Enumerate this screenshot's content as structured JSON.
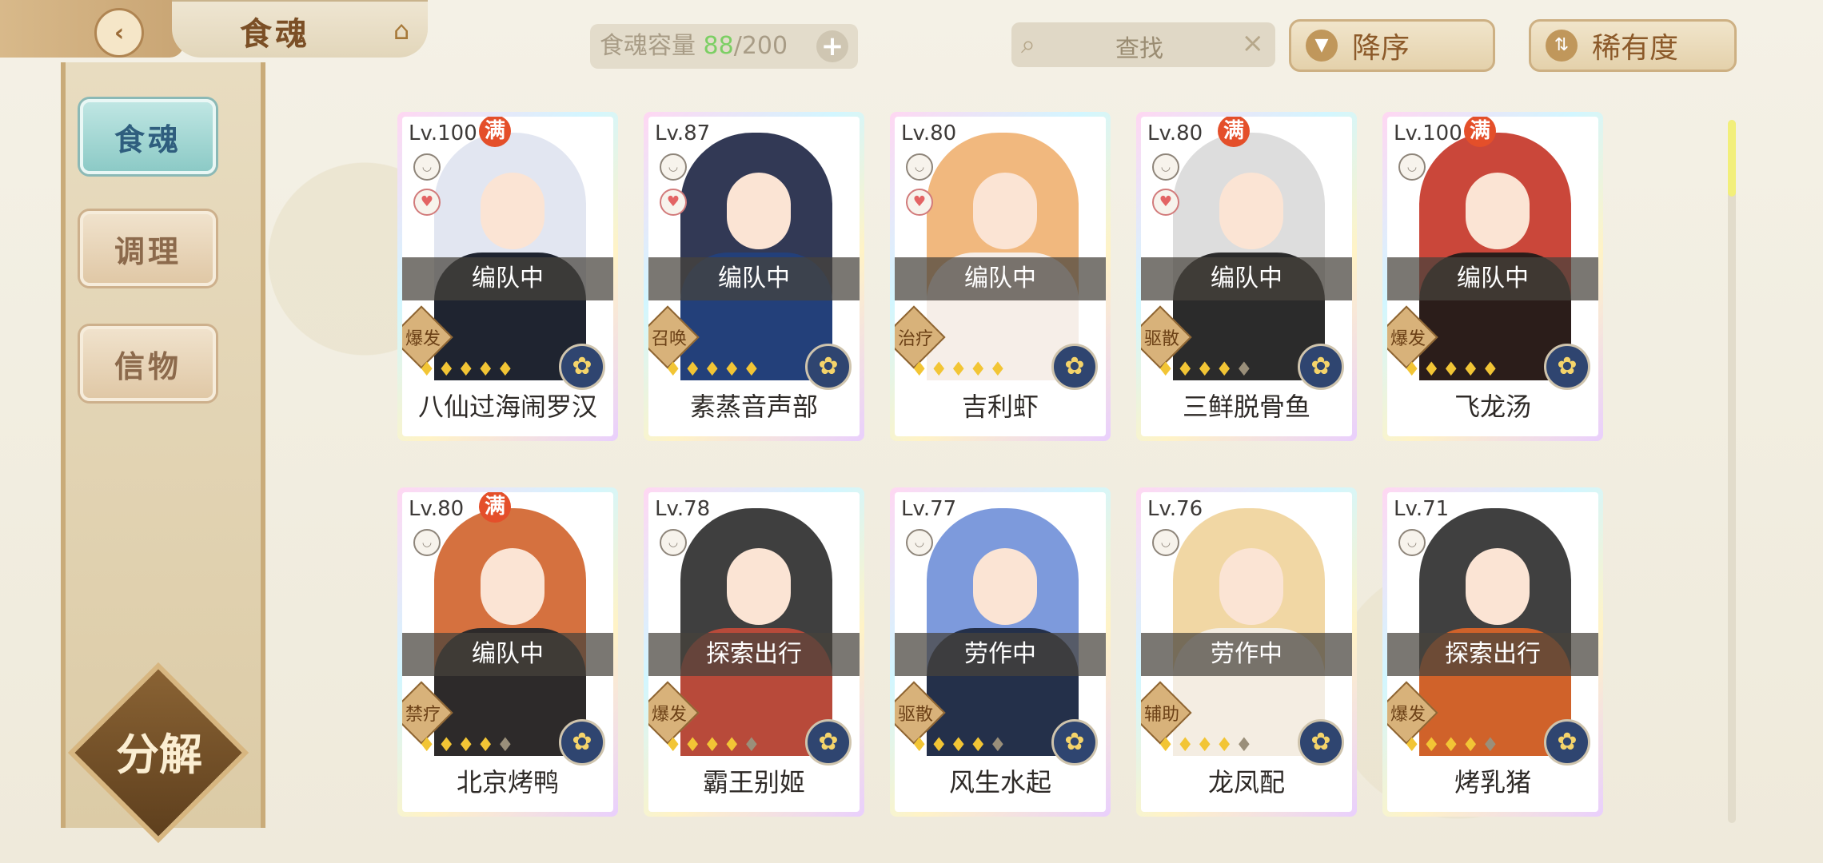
{
  "header": {
    "back_icon": "back-arrow-icon",
    "title": "食魂",
    "crown_icon": "pavilion-icon",
    "capacity_label": "食魂容量",
    "capacity_current": "88",
    "capacity_total": "/200",
    "capacity_add": "+",
    "search_placeholder": "查找",
    "search_clear": "×",
    "sort_order_label": "降序",
    "sort_key_label": "稀有度"
  },
  "sidebar": {
    "tabs": [
      {
        "label": "食魂",
        "active": true
      },
      {
        "label": "调理",
        "active": false
      },
      {
        "label": "信物",
        "active": false
      }
    ],
    "decompose_label": "分解"
  },
  "colors": {
    "accent": "#c9a574",
    "active_tab": "#8ccac6",
    "capacity_current": "#7ccf64",
    "full_badge": "#e44f2a"
  },
  "cards": [
    {
      "level": "Lv.100",
      "full": "满",
      "status": "编队中",
      "role": "爆发",
      "stars": 5,
      "name": "八仙过海闹罗汉",
      "heart": true
    },
    {
      "level": "Lv.87",
      "full": "",
      "status": "编队中",
      "role": "召唤",
      "stars": 5,
      "name": "素蒸音声部",
      "heart": true
    },
    {
      "level": "Lv.80",
      "full": "",
      "status": "编队中",
      "role": "治疗",
      "stars": 5,
      "name": "吉利虾",
      "heart": true
    },
    {
      "level": "Lv.80",
      "full": "满",
      "status": "编队中",
      "role": "驱散",
      "stars": 4,
      "name": "三鲜脱骨鱼",
      "heart": true
    },
    {
      "level": "Lv.100",
      "full": "满",
      "status": "编队中",
      "role": "爆发",
      "stars": 5,
      "name": "飞龙汤",
      "heart": false
    },
    {
      "level": "Lv.80",
      "full": "满",
      "status": "编队中",
      "role": "禁疗",
      "stars": 4,
      "name": "北京烤鸭",
      "heart": false
    },
    {
      "level": "Lv.78",
      "full": "",
      "status": "探索出行",
      "role": "爆发",
      "stars": 4,
      "name": "霸王别姬",
      "heart": false
    },
    {
      "level": "Lv.77",
      "full": "",
      "status": "劳作中",
      "role": "驱散",
      "stars": 4,
      "name": "风生水起",
      "heart": false
    },
    {
      "level": "Lv.76",
      "full": "",
      "status": "劳作中",
      "role": "辅助",
      "stars": 4,
      "name": "龙凤配",
      "heart": false
    },
    {
      "level": "Lv.71",
      "full": "",
      "status": "探索出行",
      "role": "爆发",
      "stars": 4,
      "name": "烤乳猪",
      "heart": false
    }
  ]
}
